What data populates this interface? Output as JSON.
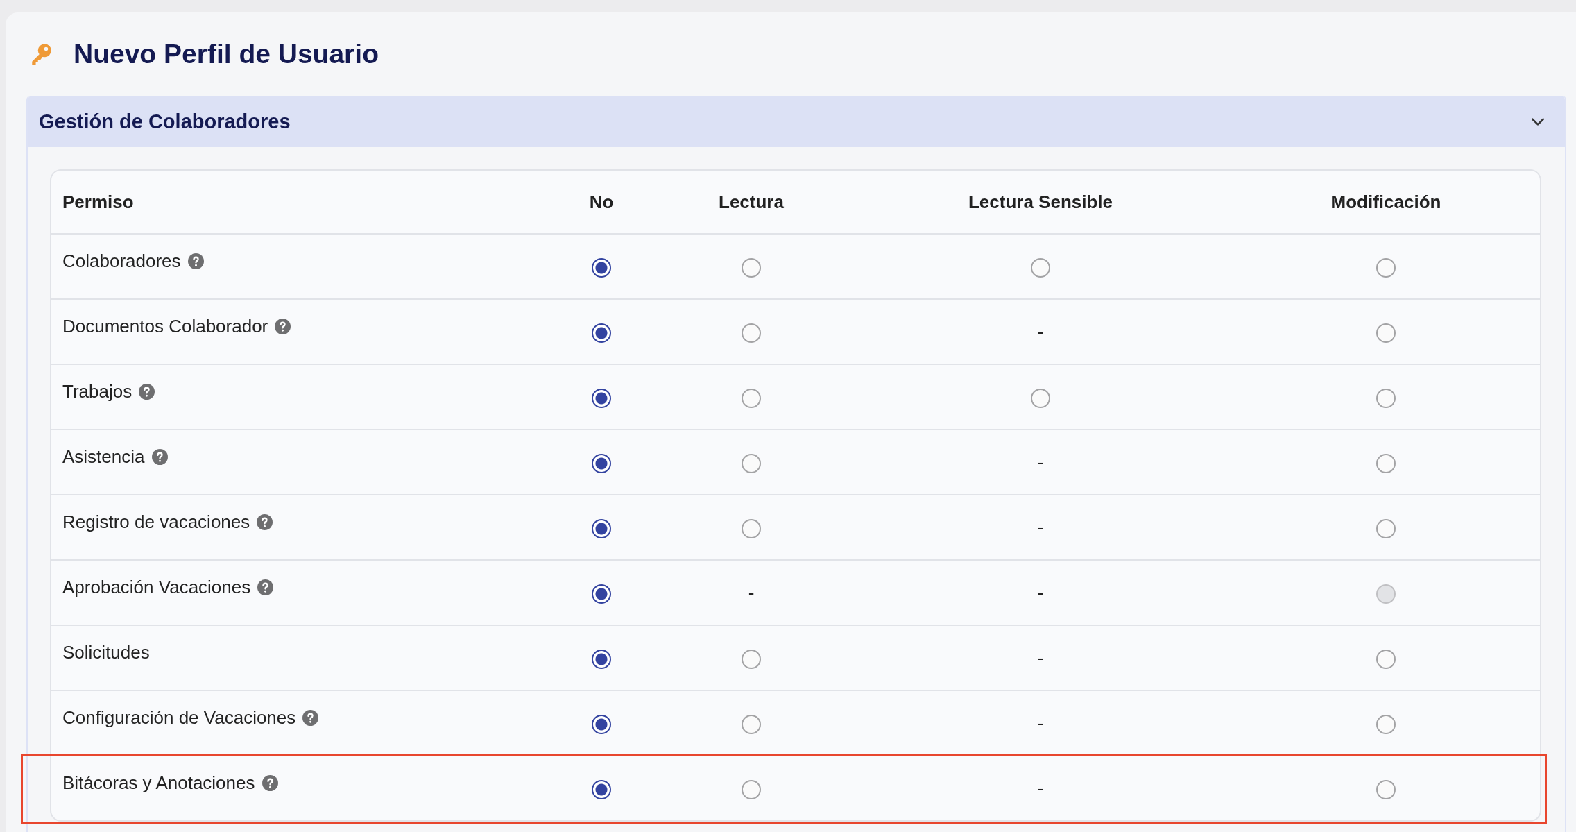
{
  "page": {
    "title": "Nuevo Perfil de Usuario"
  },
  "section": {
    "title": "Gestión de Colaboradores",
    "expanded": true
  },
  "table": {
    "columns": [
      "Permiso",
      "No",
      "Lectura",
      "Lectura Sensible",
      "Modificación"
    ],
    "rows": [
      {
        "highlighted": false,
        "cells": [
          {
            "kind": "name",
            "text": "Colaboradores",
            "help": true
          },
          {
            "kind": "radio",
            "selected": true,
            "disabled": false
          },
          {
            "kind": "radio",
            "selected": false,
            "disabled": false
          },
          {
            "kind": "radio",
            "selected": false,
            "disabled": false
          },
          {
            "kind": "radio",
            "selected": false,
            "disabled": false
          }
        ]
      },
      {
        "highlighted": false,
        "cells": [
          {
            "kind": "name",
            "text": "Documentos Colaborador",
            "help": true
          },
          {
            "kind": "radio",
            "selected": true,
            "disabled": false
          },
          {
            "kind": "radio",
            "selected": false,
            "disabled": false
          },
          {
            "kind": "dash",
            "text": "-"
          },
          {
            "kind": "radio",
            "selected": false,
            "disabled": false
          }
        ]
      },
      {
        "highlighted": false,
        "cells": [
          {
            "kind": "name",
            "text": "Trabajos",
            "help": true
          },
          {
            "kind": "radio",
            "selected": true,
            "disabled": false
          },
          {
            "kind": "radio",
            "selected": false,
            "disabled": false
          },
          {
            "kind": "radio",
            "selected": false,
            "disabled": false
          },
          {
            "kind": "radio",
            "selected": false,
            "disabled": false
          }
        ]
      },
      {
        "highlighted": false,
        "cells": [
          {
            "kind": "name",
            "text": "Asistencia",
            "help": true
          },
          {
            "kind": "radio",
            "selected": true,
            "disabled": false
          },
          {
            "kind": "radio",
            "selected": false,
            "disabled": false
          },
          {
            "kind": "dash",
            "text": "-"
          },
          {
            "kind": "radio",
            "selected": false,
            "disabled": false
          }
        ]
      },
      {
        "highlighted": false,
        "cells": [
          {
            "kind": "name",
            "text": "Registro de vacaciones",
            "help": true
          },
          {
            "kind": "radio",
            "selected": true,
            "disabled": false
          },
          {
            "kind": "radio",
            "selected": false,
            "disabled": false
          },
          {
            "kind": "dash",
            "text": "-"
          },
          {
            "kind": "radio",
            "selected": false,
            "disabled": false
          }
        ]
      },
      {
        "highlighted": false,
        "cells": [
          {
            "kind": "name",
            "text": "Aprobación Vacaciones",
            "help": true
          },
          {
            "kind": "radio",
            "selected": true,
            "disabled": false
          },
          {
            "kind": "dash",
            "text": "-"
          },
          {
            "kind": "dash",
            "text": "-"
          },
          {
            "kind": "radio",
            "selected": false,
            "disabled": true
          }
        ]
      },
      {
        "highlighted": false,
        "cells": [
          {
            "kind": "name",
            "text": "Solicitudes",
            "help": false
          },
          {
            "kind": "radio",
            "selected": true,
            "disabled": false
          },
          {
            "kind": "radio",
            "selected": false,
            "disabled": false
          },
          {
            "kind": "dash",
            "text": "-"
          },
          {
            "kind": "radio",
            "selected": false,
            "disabled": false
          }
        ]
      },
      {
        "highlighted": false,
        "cells": [
          {
            "kind": "name",
            "text": "Configuración de Vacaciones",
            "help": true
          },
          {
            "kind": "radio",
            "selected": true,
            "disabled": false
          },
          {
            "kind": "radio",
            "selected": false,
            "disabled": false
          },
          {
            "kind": "dash",
            "text": "-"
          },
          {
            "kind": "radio",
            "selected": false,
            "disabled": false
          }
        ]
      },
      {
        "highlighted": true,
        "cells": [
          {
            "kind": "name",
            "text": "Bitácoras y Anotaciones",
            "help": true
          },
          {
            "kind": "radio",
            "selected": true,
            "disabled": false
          },
          {
            "kind": "radio",
            "selected": false,
            "disabled": false
          },
          {
            "kind": "dash",
            "text": "-"
          },
          {
            "kind": "radio",
            "selected": false,
            "disabled": false
          }
        ]
      }
    ]
  }
}
